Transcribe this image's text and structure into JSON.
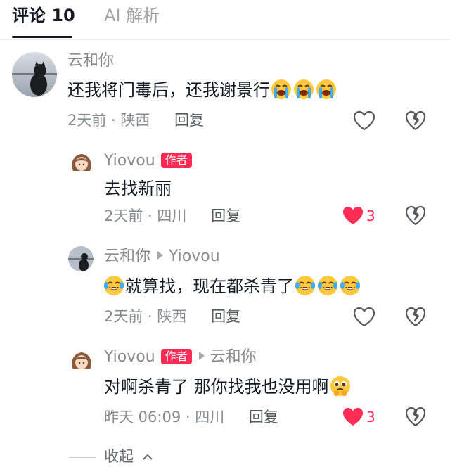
{
  "tabs": {
    "comments_label": "评论 10",
    "ai_label": "AI 解析"
  },
  "comments": [
    {
      "author": "云和你",
      "text": "还我将门毒后，还我谢景行",
      "time": "2天前",
      "location": "陕西",
      "reply_label": "回复",
      "emoji": "crying-face"
    },
    {
      "author": "Yiovou",
      "badge": "作者",
      "text": "去找新丽",
      "time": "2天前",
      "location": "四川",
      "reply_label": "回复",
      "likes": "3"
    },
    {
      "author": "云和你",
      "reply_to": "Yiovou",
      "text": "就算找，现在都杀青了",
      "time": "2天前",
      "location": "陕西",
      "reply_label": "回复",
      "emoji": "tears-of-joy"
    },
    {
      "author": "Yiovou",
      "badge": "作者",
      "reply_to": "云和你",
      "text": "对啊杀青了 那你找我也没用啊",
      "time": "昨天 06:09",
      "location": "四川",
      "reply_label": "回复",
      "likes": "3",
      "emoji": "holding-back-tears"
    }
  ],
  "collapse_label": "收起",
  "colors": {
    "accent": "#fe2c55",
    "text": "#161823",
    "muted": "#8a8b91"
  }
}
